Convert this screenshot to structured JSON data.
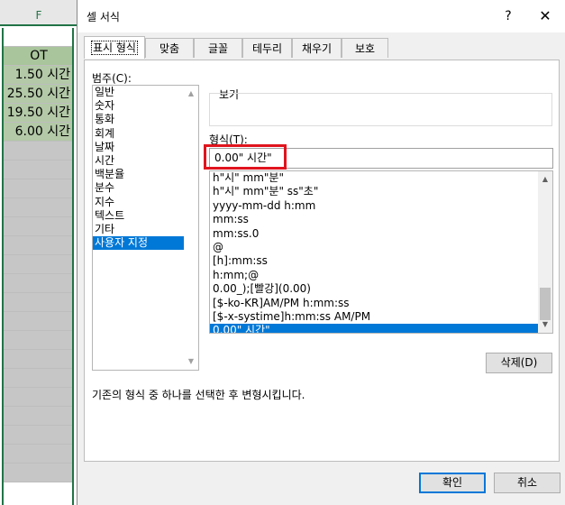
{
  "sheet": {
    "column_header": "F",
    "header_cell": "OT",
    "cells": [
      "1.50 시간",
      "25.50 시간",
      "19.50 시간",
      "6.00 시간"
    ],
    "blank_rows": 18
  },
  "dialog": {
    "title": "셀 서식",
    "help_label": "?",
    "close_label": "✕",
    "tabs": [
      "표시 형식",
      "맞춤",
      "글꼴",
      "테두리",
      "채우기",
      "보호"
    ],
    "category_label": "범주(C):",
    "categories": [
      "일반",
      "숫자",
      "통화",
      "회계",
      "날짜",
      "시간",
      "백분율",
      "분수",
      "지수",
      "텍스트",
      "기타",
      "사용자 지정"
    ],
    "selected_category": "사용자 지정",
    "preview_label": "보기",
    "format_label": "형식(T):",
    "format_value": "0.00\" 시간\"",
    "format_list": [
      "h\"시\" mm\"분\"",
      "h\"시\" mm\"분\" ss\"초\"",
      "yyyy-mm-dd h:mm",
      "mm:ss",
      "mm:ss.0",
      "@",
      "[h]:mm:ss",
      "h:mm;@",
      "0.00_);[빨강](0.00)",
      "[$-ko-KR]AM/PM h:mm:ss",
      "[$-x-systime]h:mm:ss AM/PM",
      "0.00\" 시간\""
    ],
    "selected_format": "0.00\" 시간\"",
    "delete_button": "삭제(D)",
    "description": "기존의 형식 중 하나를 선택한 후 변형시킵니다.",
    "ok_button": "확인",
    "cancel_button": "취소"
  },
  "colors": {
    "accent": "#0078d7",
    "highlight": "#e0141e",
    "excel_green": "#217346"
  }
}
